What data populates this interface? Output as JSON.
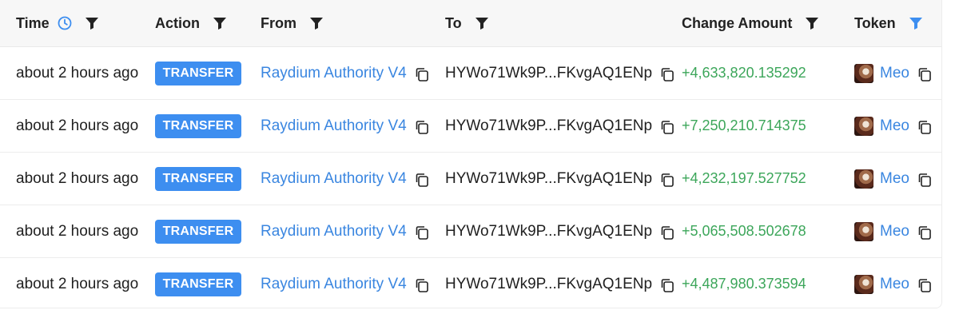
{
  "headers": {
    "time": "Time",
    "action": "Action",
    "from": "From",
    "to": "To",
    "change_amount": "Change Amount",
    "token": "Token"
  },
  "icons": {
    "time_header": "clock-icon",
    "filter": "filter-icon",
    "copy": "copy-icon",
    "token_avatar": "token-avatar"
  },
  "colors": {
    "accent": "#3d8ef0",
    "link": "#3a86e0",
    "positive": "#3ca65a",
    "header_bg": "#f7f7f7"
  },
  "rows": [
    {
      "time": "about 2 hours ago",
      "action": "TRANSFER",
      "from": "Raydium Authority V4",
      "to": "HYWo71Wk9P...FKvgAQ1ENp",
      "amount": "+4,633,820.135292",
      "token": "Meo"
    },
    {
      "time": "about 2 hours ago",
      "action": "TRANSFER",
      "from": "Raydium Authority V4",
      "to": "HYWo71Wk9P...FKvgAQ1ENp",
      "amount": "+7,250,210.714375",
      "token": "Meo"
    },
    {
      "time": "about 2 hours ago",
      "action": "TRANSFER",
      "from": "Raydium Authority V4",
      "to": "HYWo71Wk9P...FKvgAQ1ENp",
      "amount": "+4,232,197.527752",
      "token": "Meo"
    },
    {
      "time": "about 2 hours ago",
      "action": "TRANSFER",
      "from": "Raydium Authority V4",
      "to": "HYWo71Wk9P...FKvgAQ1ENp",
      "amount": "+5,065,508.502678",
      "token": "Meo"
    },
    {
      "time": "about 2 hours ago",
      "action": "TRANSFER",
      "from": "Raydium Authority V4",
      "to": "HYWo71Wk9P...FKvgAQ1ENp",
      "amount": "+4,487,980.373594",
      "token": "Meo"
    }
  ]
}
